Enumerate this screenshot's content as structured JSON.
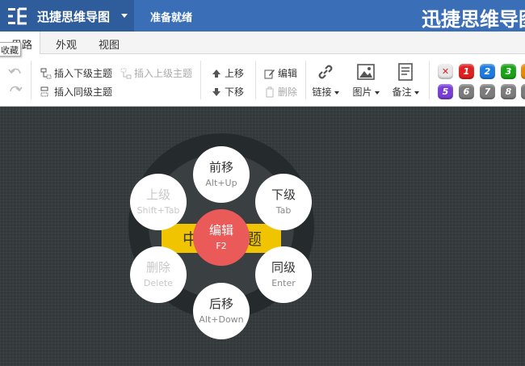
{
  "app": {
    "name": "迅捷思维导图",
    "status": "准备就绪",
    "document_title": "迅捷思维导图"
  },
  "tabs": [
    {
      "label": "思路"
    },
    {
      "label": "外观"
    },
    {
      "label": "视图"
    }
  ],
  "tooltip": "收藏",
  "toolbar": {
    "insert_child": "插入下级主题",
    "insert_parent": "插入上级主题",
    "insert_sibling": "插入同级主题",
    "move_up": "上移",
    "move_down": "下移",
    "edit": "编辑",
    "delete": "删除",
    "link": "链接",
    "image": "图片",
    "note": "备注"
  },
  "priorities": [
    {
      "label": "✕",
      "color": "#e8e8e8"
    },
    {
      "label": "1",
      "color": "#e02020"
    },
    {
      "label": "2",
      "color": "#1e7be0"
    },
    {
      "label": "3",
      "color": "#1aa31a"
    },
    {
      "label": "",
      "color": "#f08c00"
    },
    {
      "label": "5",
      "color": "#7a3ed6"
    },
    {
      "label": "6",
      "color": "#7c7c7c"
    },
    {
      "label": "7",
      "color": "#7c7c7c"
    },
    {
      "label": "8",
      "color": "#7c7c7c"
    }
  ],
  "canvas": {
    "topic_left": "中",
    "topic_right": "题",
    "radial_menu": {
      "forward": {
        "label": "前移",
        "key": "Alt+Up"
      },
      "child": {
        "label": "下级",
        "key": "Tab"
      },
      "sibling": {
        "label": "同级",
        "key": "Enter"
      },
      "backward": {
        "label": "后移",
        "key": "Alt+Down"
      },
      "delete": {
        "label": "删除",
        "key": "Delete"
      },
      "parent": {
        "label": "上级",
        "key": "Shift+Tab"
      },
      "edit": {
        "label": "编辑",
        "key": "F2"
      }
    }
  },
  "colors": {
    "title_bar": "#3a6fb7",
    "app_menu": "#2f5d9c",
    "topic": "#f0c400",
    "edit_circle": "#e95a58",
    "canvas": "#33383b"
  }
}
